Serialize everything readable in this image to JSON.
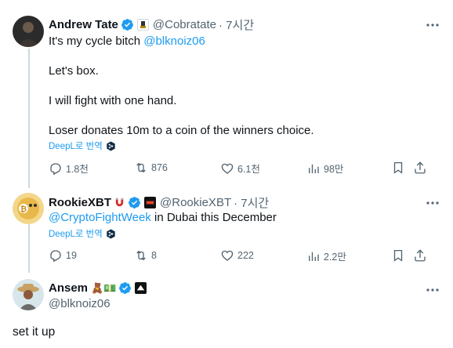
{
  "tweets": [
    {
      "name": "Andrew Tate",
      "handle": "@Cobratate",
      "time": "· 7시간",
      "lines": [
        "It's my cycle bitch "
      ],
      "mention": "@blknoiz06",
      "body_lines": [
        "Let's box.",
        "I will fight with one hand.",
        "Loser donates 10m to a coin of the winners choice."
      ],
      "translate": "DeepL로 번역",
      "stats": {
        "replies": "1.8천",
        "retweets": "876",
        "likes": "6.1천",
        "views": "98만"
      }
    },
    {
      "name": "RookieXBT",
      "handle": "@RookieXBT",
      "time": "· 7시간",
      "mention": "@CryptoFightWeek",
      "text_after": " in Dubai this December",
      "translate": "DeepL로 번역",
      "stats": {
        "replies": "19",
        "retweets": "8",
        "likes": "222",
        "views": "2.2만"
      }
    },
    {
      "name": "Ansem",
      "emoji": "🧸💵",
      "handle": "@blknoiz06",
      "body": "set it up"
    }
  ],
  "colors": {
    "accent": "#1d9bf0",
    "muted": "#536471",
    "text": "#0f1419",
    "line": "#cfd9de"
  }
}
